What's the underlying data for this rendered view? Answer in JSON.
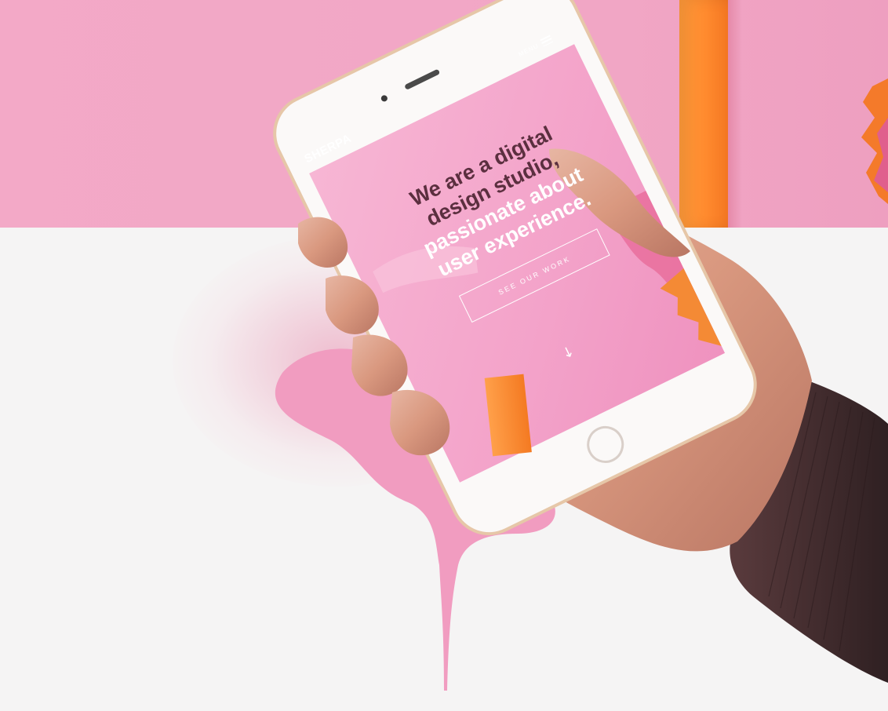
{
  "phone_screen": {
    "brand": "SHERPA",
    "menu_label": "MENU",
    "headline_dark_line1": "We are a digital",
    "headline_dark_line2": "design studio,",
    "headline_light_line1": "passionate about",
    "headline_light_line2": "user experience.",
    "cta_label": "SEE OUR WORK",
    "scroll_icon": "arrow-down-icon",
    "menu_icon": "hamburger-icon"
  },
  "colors": {
    "background_wall": "#f3a9c7",
    "floor": "#f5f4f4",
    "pillar": "#ff8a2e",
    "screen_pink": "#f4a3cb",
    "headline_dark": "#5b2f3f",
    "paint_drip": "#f19cc0",
    "sleeve": "#3d2a2c"
  }
}
